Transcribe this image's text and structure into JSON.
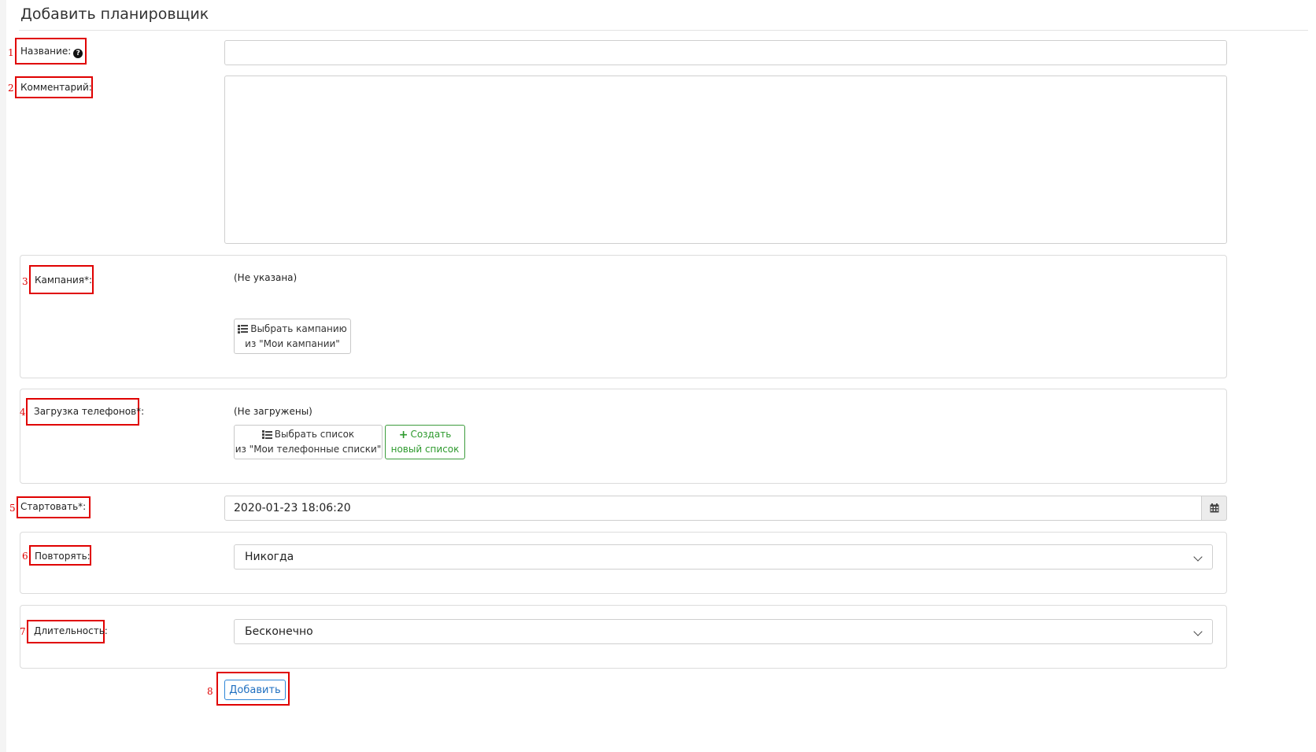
{
  "page": {
    "title": "Добавить планировщик"
  },
  "fields": {
    "name": {
      "number": "1",
      "label": "Название:",
      "value": ""
    },
    "comment": {
      "number": "2",
      "label": "Комментарий:",
      "value": ""
    },
    "campaign": {
      "number": "3",
      "label": "Кампания*:",
      "status": "(Не указана)",
      "select_button_line1": "Выбрать кампанию",
      "select_button_line2": "из \"Мои кампании\""
    },
    "phones": {
      "number": "4",
      "label": "Загрузка телефонов*:",
      "status": "(Не загружены)",
      "select_button_line1": "Выбрать список",
      "select_button_line2": "из \"Мои телефонные списки\"",
      "create_button_line1": "Создать",
      "create_button_line2": "новый список"
    },
    "start": {
      "number": "5",
      "label": "Стартовать*:",
      "value": "2020-01-23 18:06:20"
    },
    "repeat": {
      "number": "6",
      "label": "Повторять:",
      "value": "Никогда"
    },
    "duration": {
      "number": "7",
      "label": "Длительность:",
      "value": "Бесконечно"
    }
  },
  "submit": {
    "number": "8",
    "label": "Добавить"
  },
  "icons": {
    "help": "question-circle-icon",
    "list": "list-icon",
    "plus": "plus-icon",
    "calendar": "calendar-icon",
    "chevron": "chevron-down-icon"
  },
  "colors": {
    "annotation": "#e00000",
    "primary": "#1f6fc0",
    "success": "#2e9a2e"
  }
}
